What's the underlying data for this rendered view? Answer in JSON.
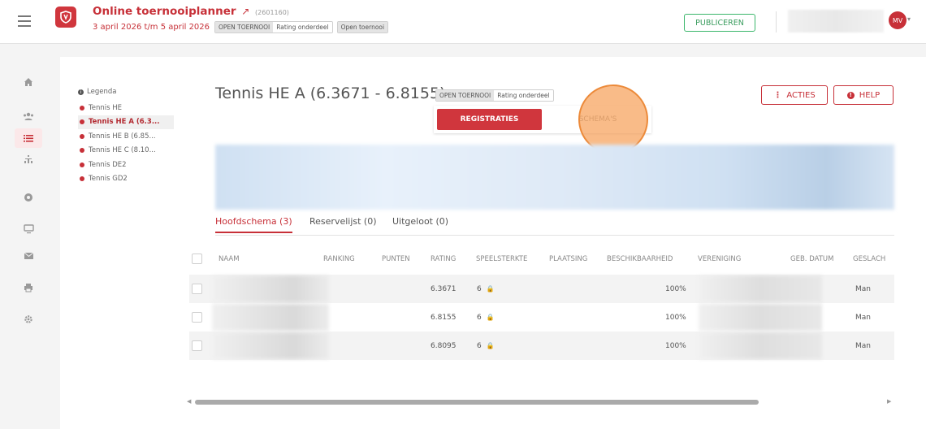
{
  "header": {
    "title": "Online toernooiplanner",
    "id": "(2601160)",
    "dates": "3 april 2026 t/m 5 april 2026",
    "chips": [
      "OPEN TOERNOOI",
      "Rating onderdeel",
      "Open toernooi"
    ],
    "publish_label": "PUBLICEREN",
    "avatar_initials": "MV"
  },
  "rail": {
    "icons": [
      "home-icon",
      "users-icon",
      "list-icon",
      "hierarchy-icon",
      "ball-icon",
      "monitor-icon",
      "mail-icon",
      "print-icon",
      "settings-icon"
    ]
  },
  "legend": {
    "title": "Legenda",
    "items": [
      "Tennis HE",
      "Tennis HE A (6.3...",
      "Tennis HE B (6.85...",
      "Tennis HE C (8.10...",
      "Tennis DE2",
      "Tennis GD2"
    ],
    "active_index": 1
  },
  "main": {
    "title": "Tennis HE A (6.3671 - 6.8155)",
    "chips": [
      "OPEN TOERNOOI",
      "Rating onderdeel"
    ],
    "acties_label": "ACTIES",
    "help_label": "HELP",
    "seg_left": "REGISTRATIES",
    "seg_right": "SCHEMA'S",
    "tabs": [
      "Hoofdschema (3)",
      "Reservelijst (0)",
      "Uitgeloot (0)"
    ]
  },
  "table": {
    "headers": [
      "NAAM",
      "RANKING",
      "PUNTEN",
      "RATING",
      "SPEELSTERKTE",
      "PLAATSING",
      "BESCHIKBAARHEID",
      "VERENIGING",
      "GEB. DATUM",
      "GESLACH"
    ],
    "rows": [
      {
        "rating": "6.3671",
        "speelsterkte": "6",
        "beschikbaarheid": "100%",
        "geslacht": "Man"
      },
      {
        "rating": "6.8155",
        "speelsterkte": "6",
        "beschikbaarheid": "100%",
        "geslacht": "Man"
      },
      {
        "rating": "6.8095",
        "speelsterkte": "6",
        "beschikbaarheid": "100%",
        "geslacht": "Man"
      }
    ]
  },
  "colors": {
    "accent": "#c73038",
    "publish": "#3bb66b",
    "highlight": "#f69e56"
  }
}
